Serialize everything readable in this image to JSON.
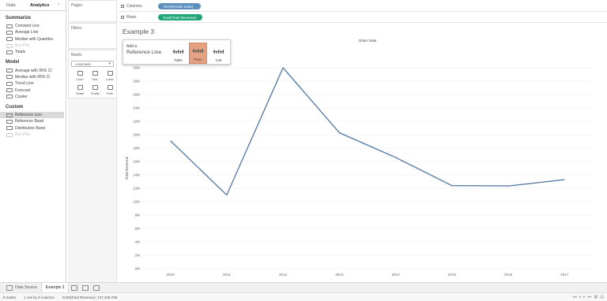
{
  "left_pane": {
    "tabs": [
      "Data",
      "Analytics"
    ],
    "collapse_glyph": "‹",
    "sections": [
      {
        "title": "Summarize",
        "items": [
          {
            "label": "Constant Line",
            "dim": false
          },
          {
            "label": "Average Line",
            "dim": false
          },
          {
            "label": "Median with Quartiles",
            "dim": false
          },
          {
            "label": "Box Plot",
            "dim": true
          },
          {
            "label": "Totals",
            "dim": false
          }
        ]
      },
      {
        "title": "Model",
        "items": [
          {
            "label": "Average with 95% CI",
            "dim": false
          },
          {
            "label": "Median with 95% CI",
            "dim": false
          },
          {
            "label": "Trend Line",
            "dim": false
          },
          {
            "label": "Forecast",
            "dim": false
          },
          {
            "label": "Cluster",
            "dim": false
          }
        ]
      },
      {
        "title": "Custom",
        "items": [
          {
            "label": "Reference Line",
            "dim": false,
            "selected": true
          },
          {
            "label": "Reference Band",
            "dim": false
          },
          {
            "label": "Distribution Band",
            "dim": false
          },
          {
            "label": "Box Plot",
            "dim": true
          }
        ]
      }
    ]
  },
  "shelves": {
    "pages": "Pages",
    "filters": "Filters",
    "marks": "Marks",
    "marks_type": "Automatic",
    "mark_buttons": [
      "Color",
      "Size",
      "Label",
      "Detail",
      "Tooltip",
      "Path"
    ]
  },
  "columns": {
    "label": "Columns",
    "pill": "YEAR(Order Date)",
    "pill_color": "#5b8fbd"
  },
  "rows": {
    "label": "Rows",
    "pill": "SUM(Total Revenue)",
    "pill_color": "#20a47a"
  },
  "sheet_title": "Example 3",
  "drop_target": {
    "line1": "Add a",
    "line2": "Reference Line",
    "options": [
      "Table",
      "Pane",
      "Cell"
    ],
    "active": "Pane",
    "accent": "#e5a283"
  },
  "chart_data": {
    "type": "line",
    "title": "Order Date",
    "xlabel": "",
    "ylabel": "Total Revenue",
    "x": [
      "2010",
      "2011",
      "2012",
      "2013",
      "2014",
      "2015",
      "2016",
      "2017"
    ],
    "series": [
      {
        "values": [
          19100000,
          11000000,
          30000000,
          20300000,
          16600000,
          12400000,
          12350000,
          13300000
        ],
        "color": "#5b7fa6"
      }
    ],
    "y_ticks": [
      "0M",
      "2M",
      "4M",
      "6M",
      "8M",
      "10M",
      "12M",
      "14M",
      "16M",
      "18M",
      "20M",
      "22M",
      "24M",
      "26M",
      "28M",
      "30M"
    ],
    "ylim": [
      0,
      30000000
    ],
    "grid": "horizontal"
  },
  "bottom_tabs": {
    "data_source": "Data Source",
    "active_sheet": "Example 3"
  },
  "status": {
    "marks": "8 marks",
    "dims": "1 row by 8 columns",
    "sum": "SUM(Total Revenue): 137,348,768"
  }
}
